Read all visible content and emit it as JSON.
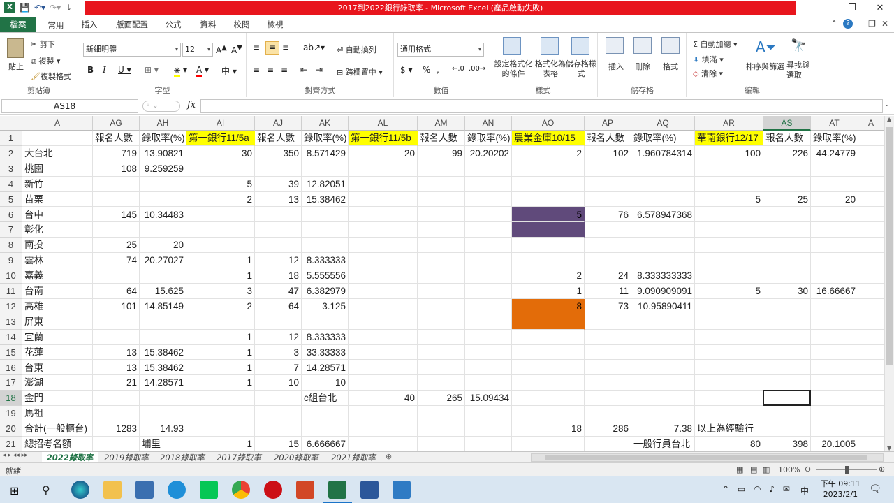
{
  "window": {
    "title": "2017到2022銀行錄取率 - Microsoft Excel (產品啟動失敗)",
    "controls": [
      "—",
      "❐",
      "✕"
    ]
  },
  "ribbon_tabs": {
    "file": "檔案",
    "home": "常用",
    "insert": "插入",
    "layout": "版面配置",
    "formulas": "公式",
    "data": "資料",
    "review": "校閱",
    "view": "檢視"
  },
  "ribbon": {
    "clipboard": {
      "label": "剪貼簿",
      "paste": "貼上",
      "cut": "剪下",
      "copy": "複製",
      "format_painter": "複製格式"
    },
    "font": {
      "label": "字型",
      "name": "新細明體",
      "size": "12"
    },
    "alignment": {
      "label": "對齊方式",
      "wrap": "自動換列",
      "merge": "跨欄置中"
    },
    "number": {
      "label": "數值",
      "format": "通用格式"
    },
    "styles": {
      "label": "樣式",
      "cond": "設定格式化的條件",
      "table": "格式化為表格",
      "cell": "儲存格樣式"
    },
    "cells": {
      "label": "儲存格",
      "insert": "插入",
      "delete": "刪除",
      "format": "格式"
    },
    "editing": {
      "label": "編輯",
      "autosum": "自動加總",
      "fill": "填滿",
      "clear": "清除",
      "sort": "排序與篩選",
      "find": "尋找與選取"
    }
  },
  "formula_bar": {
    "name_box": "AS18",
    "fx": "fx",
    "formula": ""
  },
  "columns": [
    "A",
    "AG",
    "AH",
    "AI",
    "AJ",
    "AK",
    "AL",
    "AM",
    "AN",
    "AO",
    "AP",
    "AQ",
    "AR",
    "AS",
    "AT",
    "A"
  ],
  "rows": [
    {
      "n": "1",
      "cells": [
        "",
        "報名人數",
        "錄取率(%)",
        "第一銀行11/5a",
        "報名人數",
        "錄取率(%)",
        "第一銀行11/5b",
        "報名人數",
        "錄取率(%)",
        "農業金庫10/15",
        "報名人數",
        "錄取率(%)",
        "華南銀行12/17",
        "報名人數",
        "錄取率(%)"
      ]
    },
    {
      "n": "2",
      "cells": [
        "大台北",
        "719",
        "13.90821",
        "30",
        "350",
        "8.571429",
        "20",
        "99",
        "20.20202",
        "2",
        "102",
        "1.960784314",
        "100",
        "226",
        "44.24779"
      ]
    },
    {
      "n": "3",
      "cells": [
        "桃園",
        "108",
        "9.259259",
        "",
        "",
        "",
        "",
        "",
        "",
        "",
        "",
        "",
        "",
        "",
        ""
      ]
    },
    {
      "n": "4",
      "cells": [
        "新竹",
        "",
        "",
        "5",
        "39",
        "12.82051",
        "",
        "",
        "",
        "",
        "",
        "",
        "",
        "",
        ""
      ]
    },
    {
      "n": "5",
      "cells": [
        "苗栗",
        "",
        "",
        "2",
        "13",
        "15.38462",
        "",
        "",
        "",
        "",
        "",
        "",
        "5",
        "25",
        "20"
      ]
    },
    {
      "n": "6",
      "cells": [
        "台中",
        "145",
        "10.34483",
        "",
        "",
        "",
        "",
        "",
        "",
        "5",
        "76",
        "6.578947368",
        "",
        "",
        ""
      ]
    },
    {
      "n": "7",
      "cells": [
        "彰化",
        "",
        "",
        "",
        "",
        "",
        "",
        "",
        "",
        "",
        "",
        "",
        "",
        "",
        ""
      ]
    },
    {
      "n": "8",
      "cells": [
        "南投",
        "25",
        "20",
        "",
        "",
        "",
        "",
        "",
        "",
        "",
        "",
        "",
        "",
        "",
        ""
      ]
    },
    {
      "n": "9",
      "cells": [
        "雲林",
        "74",
        "20.27027",
        "1",
        "12",
        "8.333333",
        "",
        "",
        "",
        "",
        "",
        "",
        "",
        "",
        ""
      ]
    },
    {
      "n": "10",
      "cells": [
        "嘉義",
        "",
        "",
        "1",
        "18",
        "5.555556",
        "",
        "",
        "",
        "2",
        "24",
        "8.333333333",
        "",
        "",
        ""
      ]
    },
    {
      "n": "11",
      "cells": [
        "台南",
        "64",
        "15.625",
        "3",
        "47",
        "6.382979",
        "",
        "",
        "",
        "1",
        "11",
        "9.090909091",
        "5",
        "30",
        "16.66667"
      ]
    },
    {
      "n": "12",
      "cells": [
        "高雄",
        "101",
        "14.85149",
        "2",
        "64",
        "3.125",
        "",
        "",
        "",
        "8",
        "73",
        "10.95890411",
        "",
        "",
        ""
      ]
    },
    {
      "n": "13",
      "cells": [
        "屏東",
        "",
        "",
        "",
        "",
        "",
        "",
        "",
        "",
        "",
        "",
        "",
        "",
        "",
        ""
      ]
    },
    {
      "n": "14",
      "cells": [
        "宜蘭",
        "",
        "",
        "1",
        "12",
        "8.333333",
        "",
        "",
        "",
        "",
        "",
        "",
        "",
        "",
        ""
      ]
    },
    {
      "n": "15",
      "cells": [
        "花蓮",
        "13",
        "15.38462",
        "1",
        "3",
        "33.33333",
        "",
        "",
        "",
        "",
        "",
        "",
        "",
        "",
        ""
      ]
    },
    {
      "n": "16",
      "cells": [
        "台東",
        "13",
        "15.38462",
        "1",
        "7",
        "14.28571",
        "",
        "",
        "",
        "",
        "",
        "",
        "",
        "",
        ""
      ]
    },
    {
      "n": "17",
      "cells": [
        "澎湖",
        "21",
        "14.28571",
        "1",
        "10",
        "10",
        "",
        "",
        "",
        "",
        "",
        "",
        "",
        "",
        ""
      ]
    },
    {
      "n": "18",
      "cells": [
        "金門",
        "",
        "",
        "",
        "",
        "c組台北",
        "40",
        "265",
        "15.09434",
        "",
        "",
        "",
        "",
        "",
        ""
      ]
    },
    {
      "n": "19",
      "cells": [
        "馬祖",
        "",
        "",
        "",
        "",
        "",
        "",
        "",
        "",
        "",
        "",
        "",
        "",
        "",
        ""
      ]
    },
    {
      "n": "20",
      "cells": [
        "合計(一般櫃台)",
        "1283",
        "14.93",
        "",
        "",
        "",
        "",
        "",
        "",
        "18",
        "286",
        "7.38",
        "以上為經驗行",
        "",
        ""
      ]
    },
    {
      "n": "21",
      "cells": [
        "總招考名額",
        "",
        "埔里",
        "1",
        "15",
        "6.666667",
        "",
        "",
        "",
        "",
        "",
        "一般行員台北",
        "80",
        "398",
        "20.1005"
      ]
    },
    {
      "n": "22",
      "cells": [
        "經驗台北",
        "",
        "北港朴子",
        "1",
        "5",
        "20",
        "",
        "",
        "",
        "",
        "",
        "",
        "",
        "",
        ""
      ]
    }
  ],
  "sheet_tabs": [
    "2022錄取率",
    "2019錄取率",
    "2018錄取率",
    "2017錄取率",
    "2020錄取率",
    "2021錄取率"
  ],
  "status": {
    "ready": "就緒",
    "zoom": "100%"
  },
  "clock": {
    "time": "下午 09:11",
    "date": "2023/2/1"
  },
  "tray": {
    "lang": "中"
  },
  "colors": {
    "yellow": "#ffff00",
    "purple": "#604a7b",
    "orange": "#e36c09",
    "excel_green": "#217346"
  }
}
